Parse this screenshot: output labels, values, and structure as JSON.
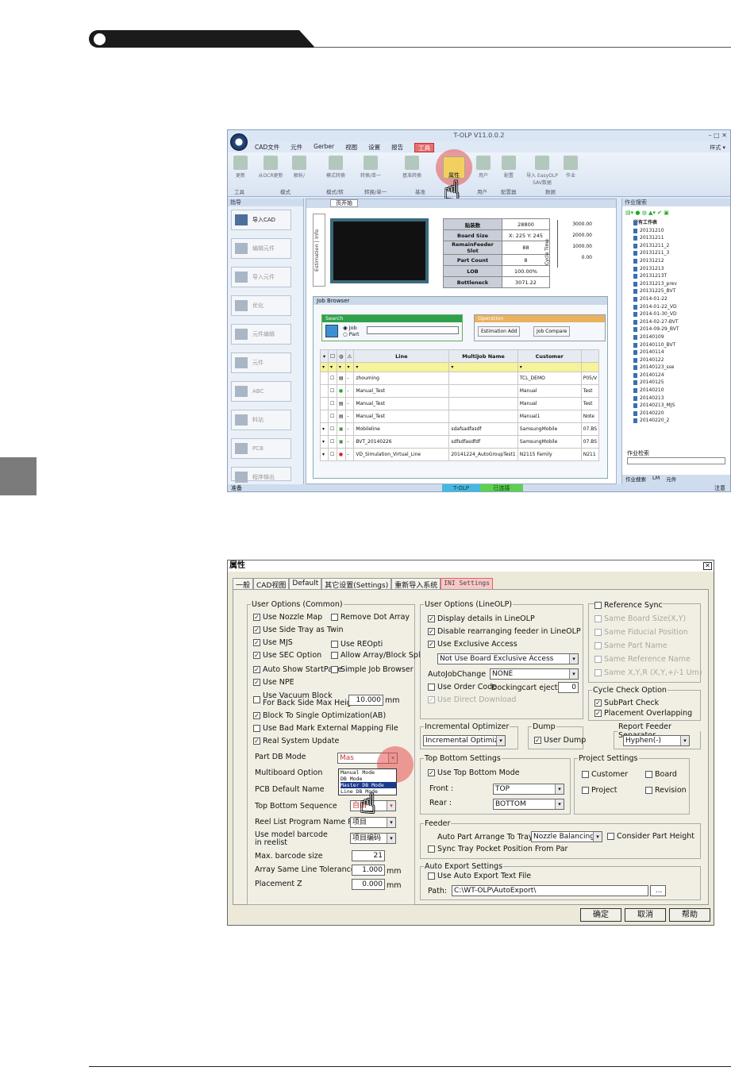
{
  "window1": {
    "title": "T-OLP V11.0.0.2",
    "menu": [
      "CAD文件",
      "元件",
      "Gerber",
      "视图",
      "设置",
      "报告",
      "工具"
    ],
    "style_label": "样式 ▾",
    "ribbon_buttons": [
      "更新",
      "从OCR更新",
      "解析/",
      "模式转换",
      "转换/单一",
      "基准转换",
      "属性",
      "用户",
      "配置",
      "导入 EasyOLP SAV数据",
      "作业"
    ],
    "ribbon_groups": [
      "工具",
      "模式",
      "模式/转",
      "转换/单一",
      "基准",
      "用户",
      "配置器",
      "数据"
    ],
    "left_pane_title": "指导",
    "left_buttons": [
      "导入CAD",
      "编辑元件",
      "导入元件",
      "优化",
      "元件编辑",
      "元件",
      "ABC",
      "料站",
      "PCB",
      "程序输出"
    ],
    "tab_label": "页开始",
    "estimation_label": "Estimation",
    "info_label": "Info",
    "stats": [
      {
        "k": "贴装数",
        "v": "28800"
      },
      {
        "k": "Board Size",
        "v": "X: 225  Y: 245"
      },
      {
        "k": "RemainFeeder Slot",
        "v": "88"
      },
      {
        "k": "Part Count",
        "v": "8"
      },
      {
        "k": "LOB",
        "v": "100.00%"
      },
      {
        "k": "Bottleneck",
        "v": "3071.22"
      }
    ],
    "cycle_ticks": [
      "3000.00",
      "2000.00",
      "1000.00",
      "0.00"
    ],
    "cycle_label": "Cycle Time",
    "job_browser": "Job Browser",
    "search_label": "Search",
    "radio_job": "Job",
    "radio_part": "Part",
    "operation_label": "Operation",
    "op_buttons": [
      "Estimation Add",
      "Job Compare"
    ],
    "grid_headers": [
      "Line",
      "MultiJob Name",
      "Customer"
    ],
    "grid_rows": [
      {
        "line": "zhouming",
        "multi": "",
        "cust": "TCL_DEMO",
        "extra": "P05/V"
      },
      {
        "line": "Manual_Test",
        "multi": "",
        "cust": "Manual",
        "extra": "Test"
      },
      {
        "line": "Manual_Test",
        "multi": "",
        "cust": "Manual",
        "extra": "Test"
      },
      {
        "line": "Manual_Test",
        "multi": "",
        "cust": "Manual1",
        "extra": "Note"
      },
      {
        "line": "Mobileline",
        "multi": "sdafsadfasdf",
        "cust": "SamsungMobile",
        "extra": "07.BS"
      },
      {
        "line": "BVT_20140226",
        "multi": "sdfsdfasdfdf",
        "cust": "SamsungMobile",
        "extra": "07.BS"
      },
      {
        "line": "VD_Simulation_Virtual_Line",
        "multi": "20141224_AutoGroupTest1",
        "cust": "N2115 Family",
        "extra": "N211"
      }
    ],
    "right_pane_title": "作业搜索",
    "tree_root": "所有工作表",
    "tree_items": [
      "20131210",
      "20131211",
      "20131211_2",
      "20131211_3",
      "20131212",
      "20131213",
      "20131213T",
      "20131213_prev",
      "20131225_BVT",
      "2014-01-22",
      "2014-01-22_VD",
      "2014-01-30_VD",
      "2014-02-27-BVT",
      "2014-09-29_BVT",
      "20140109",
      "20140110_BVT",
      "20140114",
      "20140122",
      "20140123_sse",
      "20140124",
      "20140125",
      "20140210",
      "20140213",
      "20140213_MJS",
      "20140220",
      "20140220_2"
    ],
    "job_search_label": "作业检索",
    "right_tabs": [
      "作业搜索",
      "LM",
      "元件"
    ],
    "status_left": "准备",
    "status_mid1": "T-OLP (Office)",
    "status_mid2": "已连接",
    "status_right": "注意"
  },
  "dialog": {
    "title": "属性",
    "tabs": [
      "一般",
      "CAD视图",
      "Default",
      "其它设置(Settings)",
      "重新导入系统",
      "INI Settings"
    ],
    "common_legend": "User Options (Common)",
    "common_left": [
      {
        "label": "Use Nozzle Map",
        "checked": true
      },
      {
        "label": "Use Side Tray as Twin",
        "checked": true
      },
      {
        "label": "Use MJS",
        "checked": true
      },
      {
        "label": "Use SEC Option",
        "checked": true
      },
      {
        "label": "Auto Show StartPage",
        "checked": true
      },
      {
        "label": "Use NPE",
        "checked": true
      }
    ],
    "common_right": [
      {
        "label": "Remove Dot Array",
        "checked": false
      },
      {
        "label": "Use REOpti",
        "checked": false
      },
      {
        "label": "Allow Array/Block Spl",
        "checked": false
      },
      {
        "label": "Simple Job Browser",
        "checked": false
      }
    ],
    "vacuum_label1": "Use Vacuum Block",
    "vacuum_label2": "For Back Side Max Height",
    "vacuum_value": "10.000",
    "vacuum_unit": "mm",
    "common_more": [
      {
        "label": "Block To Single Optimization(AB)",
        "checked": true
      },
      {
        "label": "Use Bad Mark External Mapping File",
        "checked": false
      },
      {
        "label": "Real System Update",
        "checked": true
      }
    ],
    "part_db_mode": "Part DB Mode",
    "part_db_options": [
      "Manual Mode",
      "DB Mode",
      "Master DB Mode",
      "Line DB Mode"
    ],
    "part_db_value": "Mas",
    "multiboard_option": "Multiboard Option",
    "pcb_default_name": "PCB Default Name",
    "top_bottom_sequence": "Top Bottom Sequence",
    "top_bottom_value": "自由",
    "reel_list_rule": "Reel List Program Name Rule",
    "reel_list_value": "项目",
    "use_model_barcode1": "Use model barcode",
    "use_model_barcode2": "in reelist",
    "use_model_barcode_value": "项目编码",
    "max_barcode": "Max. barcode size",
    "max_barcode_value": "21",
    "array_tol": "Array Same Line Tolerance",
    "array_tol_value": "1.000",
    "placement_z": "Placement Z",
    "placement_z_value": "0.000",
    "mm": "mm",
    "lineolp_legend": "User Options (LineOLP)",
    "lineolp": [
      {
        "label": "Display details in LineOLP",
        "checked": true
      },
      {
        "label": "Disable rearranging feeder in LineOLP",
        "checked": true
      },
      {
        "label": "Use Exclusive Access",
        "checked": true
      }
    ],
    "exclusive_value": "Not Use Board Exclusive Access",
    "autojob_label": "AutoJobChange",
    "autojob_value": "NONE",
    "order_code": "Use Order Code",
    "docking_label": "Dockingcart ejection",
    "docking_value": "0",
    "direct_download": "Use Direct Download",
    "ref_sync": "Reference Sync",
    "ref_items": [
      "Same Board Size(X,Y)",
      "Same Fiducial Position",
      "Same Part Name",
      "Same Reference Name",
      "Same X,Y,R (X,Y,+/-1 Um)"
    ],
    "cycle_legend": "Cycle Check Option",
    "cycle_items": [
      {
        "label": "SubPart Check",
        "checked": true
      },
      {
        "label": "Placement Overlapping",
        "checked": true
      }
    ],
    "inc_legend": "Incremental Optimizer",
    "inc_value": "Incremental Optimize",
    "dump_legend": "Dump",
    "dump_label": "User Dump",
    "report_legend": "Report Feeder Separator",
    "report_value": "Hyphen(-)",
    "tb_legend": "Top Bottom Settings",
    "tb_mode": "Use Top Bottom Mode",
    "front_label": "Front :",
    "front_value": "TOP",
    "rear_label": "Rear :",
    "rear_value": "BOTTOM",
    "project_legend": "Project Settings",
    "project_items": [
      "Customer",
      "Board",
      "Project",
      "Revision"
    ],
    "feeder_legend": "Feeder",
    "auto_part_label": "Auto Part Arrange To Tray",
    "auto_part_value": "Nozzle Balancing",
    "consider_height": "Consider Part Height",
    "sync_tray": "Sync Tray Pocket Position From Par",
    "export_legend": "Auto Export Settings",
    "export_check": "Use Auto Export Text File",
    "path_label": "Path:",
    "path_value": "C:\\WT-OLP\\AutoExport\\",
    "browse": "...",
    "ok": "确定",
    "cancel": "取消",
    "help": "帮助"
  }
}
